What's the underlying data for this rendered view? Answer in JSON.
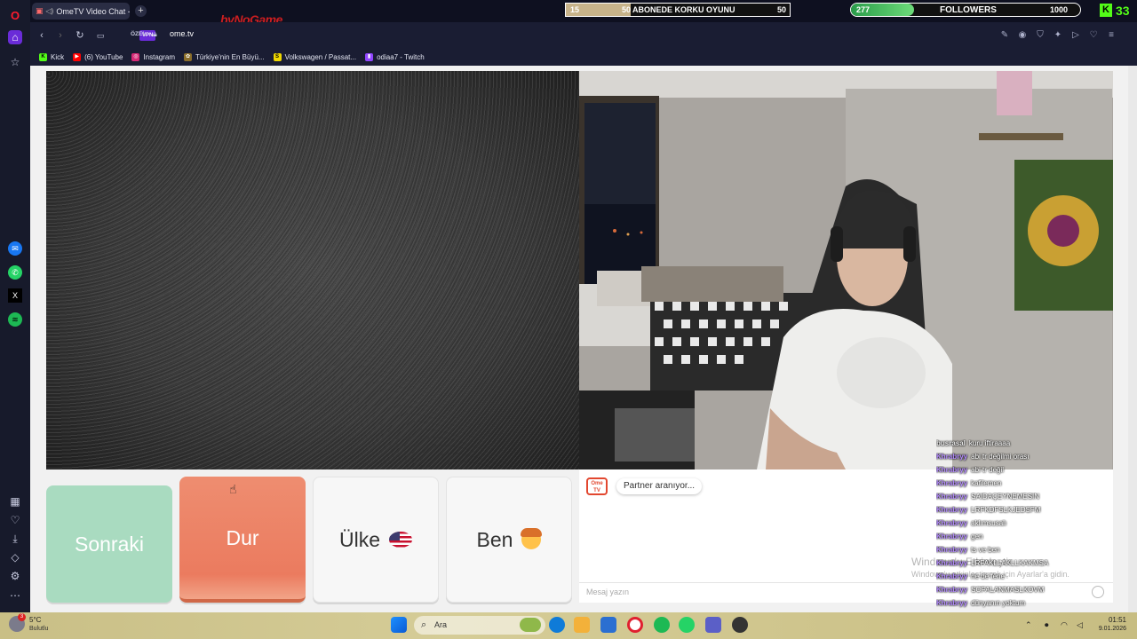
{
  "browser": {
    "tab_title": "OmeTV Video Chat -",
    "new_tab": "+",
    "private_label": "ÖZEL",
    "vpn_label": "VPN",
    "url": "ome.tv"
  },
  "bookmarks": [
    {
      "label": "Kick",
      "icon": "kick-icon",
      "color": "#53fc18"
    },
    {
      "label": "(6) YouTube",
      "icon": "youtube-icon",
      "color": "#ff0000"
    },
    {
      "label": "Instagram",
      "icon": "instagram-icon",
      "color": "#d62976"
    },
    {
      "label": "Türkiye'nin En Büyü...",
      "icon": "site-icon",
      "color": "#8a6d2a"
    },
    {
      "label": "Volkswagen / Passat...",
      "icon": "sahibinden-icon",
      "color": "#f0d800"
    },
    {
      "label": "odiaa7 - Twitch",
      "icon": "twitch-icon",
      "color": "#9146ff"
    }
  ],
  "overlay": {
    "sub_goal": {
      "current": "15",
      "goal_left": "50",
      "title": "ABONEDE KORKU OYUNU",
      "goal": "50",
      "progress": 0.29
    },
    "followers": {
      "current": "277",
      "title": "FOLLOWERS",
      "goal": "1000",
      "progress": 0.277
    },
    "kick_viewers": "33",
    "brand": "byNoGame"
  },
  "ometv": {
    "buttons": {
      "next": "Sonraki",
      "stop": "Dur",
      "country": "Ülke",
      "me": "Ben"
    },
    "status": "Partner aranıyor...",
    "logo": "Ome TV",
    "message_placeholder": "Mesaj yazın"
  },
  "stream_chat": [
    {
      "user": "busrasal",
      "text": "kuru iftiraaaa",
      "color": "#e8e8e8"
    },
    {
      "user": "Khrabryy",
      "text": "abi tr değilmi orası",
      "color": "#b58cff"
    },
    {
      "user": "Khrabryy",
      "text": "abi tr değil",
      "color": "#b58cff"
    },
    {
      "user": "Khrabryy",
      "text": "kafilemen",
      "color": "#b58cff"
    },
    {
      "user": "Khrabryy",
      "text": "SAİDAÇEYNEMESİN",
      "color": "#b58cff"
    },
    {
      "user": "Khrabryy",
      "text": "LRFKDFSLKJEDSFM",
      "color": "#b58cff"
    },
    {
      "user": "Khrabryy",
      "text": "aklımsusalı",
      "color": "#b58cff"
    },
    {
      "user": "Khrabryy",
      "text": "gen",
      "color": "#b58cff"
    },
    {
      "user": "Khrabryy",
      "text": "ts ve ben",
      "color": "#b58cff"
    },
    {
      "user": "Khrabryy",
      "text": "LRFAKLLAKLLKAKMSA",
      "color": "#b58cff"
    },
    {
      "user": "Khrabryy",
      "text": "ne de fene",
      "color": "#b58cff"
    },
    {
      "user": "Khrabryy",
      "text": "SOFALANMASLKOVM",
      "color": "#b58cff"
    },
    {
      "user": "Khrabryy",
      "text": "dünyanın yoktum",
      "color": "#b58cff"
    },
    {
      "user": "Khrabryy",
      "text": "dk",
      "color": "#b58cff"
    },
    {
      "user": "busrasal",
      "text": "yok bu gün kız gidecek",
      "color": "#e8e8e8"
    }
  ],
  "windows": {
    "watermark_title": "Windows'u Etkinleştir",
    "watermark_sub": "Windows'u etkinleştirmek için Ayarlar'a gidin.",
    "weather_temp": "5°C",
    "weather_desc": "Bulutlu",
    "weather_badge": "3",
    "search_placeholder": "Ara",
    "time": "01:51",
    "date": "9.01.2026"
  }
}
